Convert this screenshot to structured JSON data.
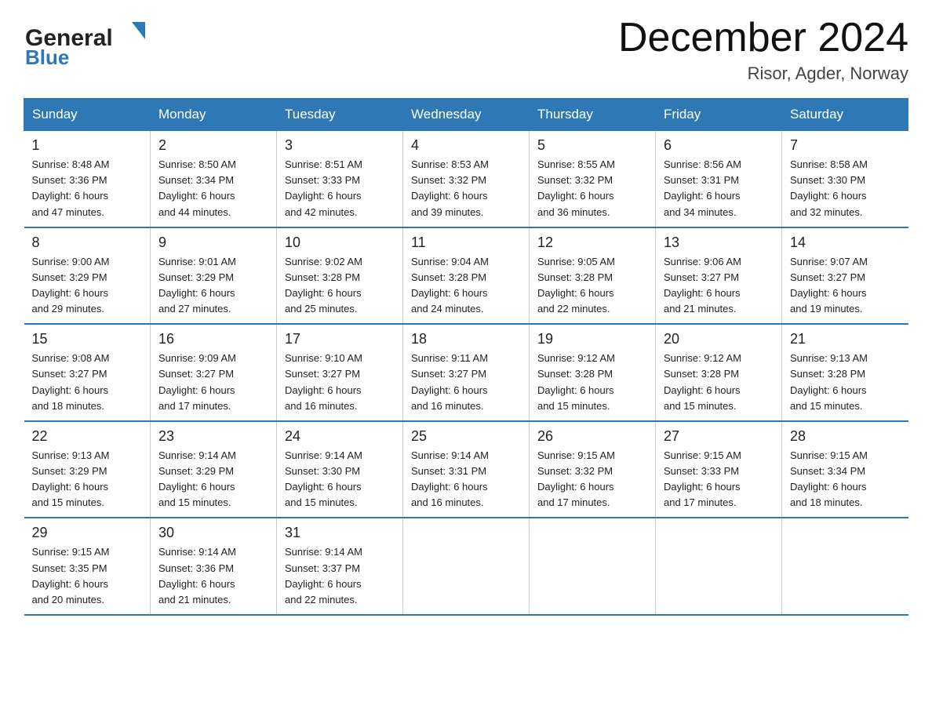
{
  "header": {
    "logo_general": "General",
    "logo_blue": "Blue",
    "month_title": "December 2024",
    "location": "Risor, Agder, Norway"
  },
  "days_of_week": [
    "Sunday",
    "Monday",
    "Tuesday",
    "Wednesday",
    "Thursday",
    "Friday",
    "Saturday"
  ],
  "weeks": [
    [
      {
        "date": "1",
        "sunrise": "8:48 AM",
        "sunset": "3:36 PM",
        "daylight": "6 hours and 47 minutes."
      },
      {
        "date": "2",
        "sunrise": "8:50 AM",
        "sunset": "3:34 PM",
        "daylight": "6 hours and 44 minutes."
      },
      {
        "date": "3",
        "sunrise": "8:51 AM",
        "sunset": "3:33 PM",
        "daylight": "6 hours and 42 minutes."
      },
      {
        "date": "4",
        "sunrise": "8:53 AM",
        "sunset": "3:32 PM",
        "daylight": "6 hours and 39 minutes."
      },
      {
        "date": "5",
        "sunrise": "8:55 AM",
        "sunset": "3:32 PM",
        "daylight": "6 hours and 36 minutes."
      },
      {
        "date": "6",
        "sunrise": "8:56 AM",
        "sunset": "3:31 PM",
        "daylight": "6 hours and 34 minutes."
      },
      {
        "date": "7",
        "sunrise": "8:58 AM",
        "sunset": "3:30 PM",
        "daylight": "6 hours and 32 minutes."
      }
    ],
    [
      {
        "date": "8",
        "sunrise": "9:00 AM",
        "sunset": "3:29 PM",
        "daylight": "6 hours and 29 minutes."
      },
      {
        "date": "9",
        "sunrise": "9:01 AM",
        "sunset": "3:29 PM",
        "daylight": "6 hours and 27 minutes."
      },
      {
        "date": "10",
        "sunrise": "9:02 AM",
        "sunset": "3:28 PM",
        "daylight": "6 hours and 25 minutes."
      },
      {
        "date": "11",
        "sunrise": "9:04 AM",
        "sunset": "3:28 PM",
        "daylight": "6 hours and 24 minutes."
      },
      {
        "date": "12",
        "sunrise": "9:05 AM",
        "sunset": "3:28 PM",
        "daylight": "6 hours and 22 minutes."
      },
      {
        "date": "13",
        "sunrise": "9:06 AM",
        "sunset": "3:27 PM",
        "daylight": "6 hours and 21 minutes."
      },
      {
        "date": "14",
        "sunrise": "9:07 AM",
        "sunset": "3:27 PM",
        "daylight": "6 hours and 19 minutes."
      }
    ],
    [
      {
        "date": "15",
        "sunrise": "9:08 AM",
        "sunset": "3:27 PM",
        "daylight": "6 hours and 18 minutes."
      },
      {
        "date": "16",
        "sunrise": "9:09 AM",
        "sunset": "3:27 PM",
        "daylight": "6 hours and 17 minutes."
      },
      {
        "date": "17",
        "sunrise": "9:10 AM",
        "sunset": "3:27 PM",
        "daylight": "6 hours and 16 minutes."
      },
      {
        "date": "18",
        "sunrise": "9:11 AM",
        "sunset": "3:27 PM",
        "daylight": "6 hours and 16 minutes."
      },
      {
        "date": "19",
        "sunrise": "9:12 AM",
        "sunset": "3:28 PM",
        "daylight": "6 hours and 15 minutes."
      },
      {
        "date": "20",
        "sunrise": "9:12 AM",
        "sunset": "3:28 PM",
        "daylight": "6 hours and 15 minutes."
      },
      {
        "date": "21",
        "sunrise": "9:13 AM",
        "sunset": "3:28 PM",
        "daylight": "6 hours and 15 minutes."
      }
    ],
    [
      {
        "date": "22",
        "sunrise": "9:13 AM",
        "sunset": "3:29 PM",
        "daylight": "6 hours and 15 minutes."
      },
      {
        "date": "23",
        "sunrise": "9:14 AM",
        "sunset": "3:29 PM",
        "daylight": "6 hours and 15 minutes."
      },
      {
        "date": "24",
        "sunrise": "9:14 AM",
        "sunset": "3:30 PM",
        "daylight": "6 hours and 15 minutes."
      },
      {
        "date": "25",
        "sunrise": "9:14 AM",
        "sunset": "3:31 PM",
        "daylight": "6 hours and 16 minutes."
      },
      {
        "date": "26",
        "sunrise": "9:15 AM",
        "sunset": "3:32 PM",
        "daylight": "6 hours and 17 minutes."
      },
      {
        "date": "27",
        "sunrise": "9:15 AM",
        "sunset": "3:33 PM",
        "daylight": "6 hours and 17 minutes."
      },
      {
        "date": "28",
        "sunrise": "9:15 AM",
        "sunset": "3:34 PM",
        "daylight": "6 hours and 18 minutes."
      }
    ],
    [
      {
        "date": "29",
        "sunrise": "9:15 AM",
        "sunset": "3:35 PM",
        "daylight": "6 hours and 20 minutes."
      },
      {
        "date": "30",
        "sunrise": "9:14 AM",
        "sunset": "3:36 PM",
        "daylight": "6 hours and 21 minutes."
      },
      {
        "date": "31",
        "sunrise": "9:14 AM",
        "sunset": "3:37 PM",
        "daylight": "6 hours and 22 minutes."
      },
      null,
      null,
      null,
      null
    ]
  ],
  "labels": {
    "sunrise": "Sunrise:",
    "sunset": "Sunset:",
    "daylight": "Daylight:"
  }
}
